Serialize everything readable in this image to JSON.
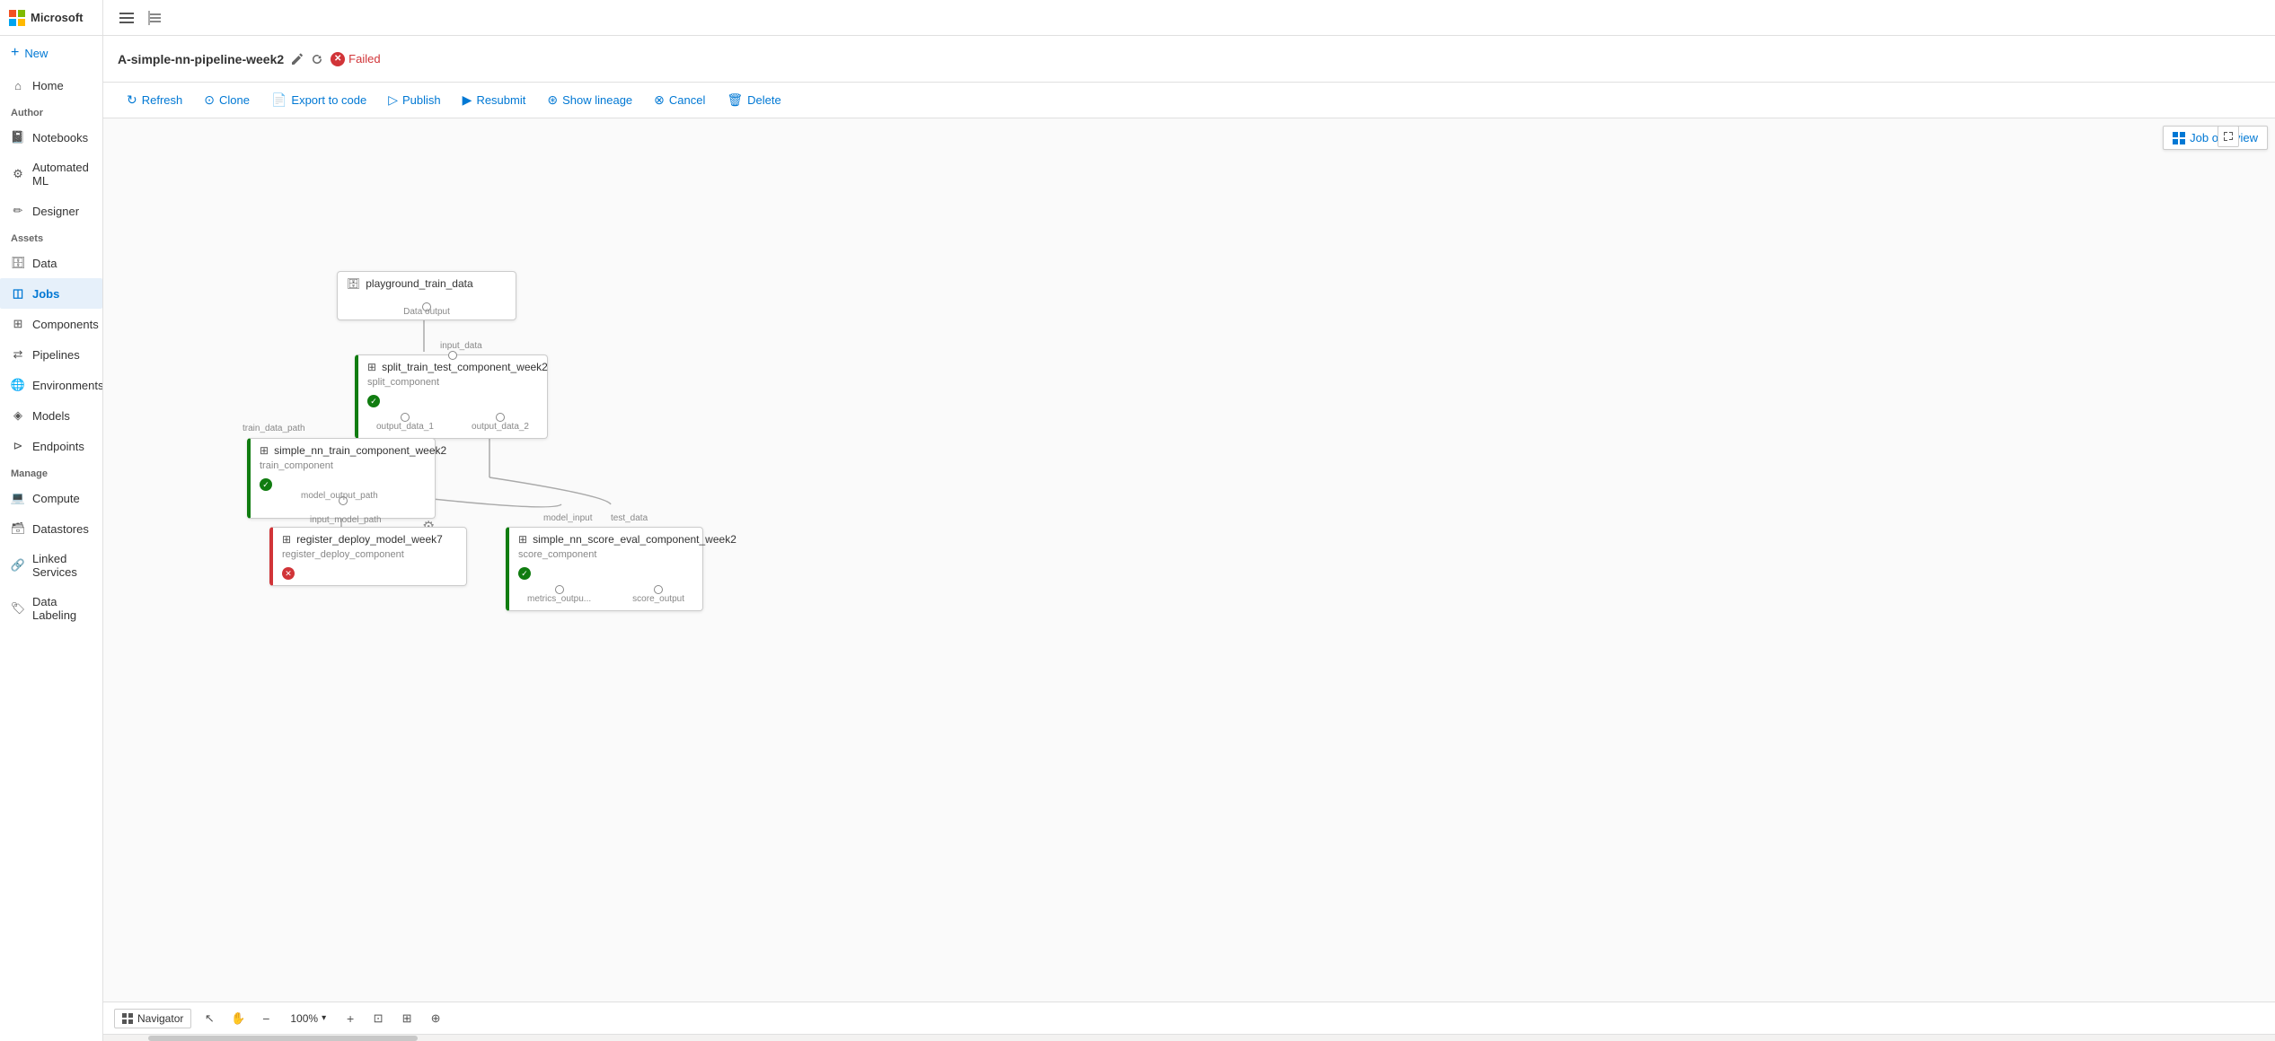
{
  "app": {
    "title": "Microsoft"
  },
  "sidebar": {
    "new_label": "New",
    "home_label": "Home",
    "author_section": "Author",
    "notebooks_label": "Notebooks",
    "automated_ml_label": "Automated ML",
    "designer_label": "Designer",
    "assets_section": "Assets",
    "data_label": "Data",
    "jobs_label": "Jobs",
    "components_label": "Components",
    "pipelines_label": "Pipelines",
    "environments_label": "Environments",
    "models_label": "Models",
    "endpoints_label": "Endpoints",
    "manage_section": "Manage",
    "compute_label": "Compute",
    "datastores_label": "Datastores",
    "linked_services_label": "Linked Services",
    "data_labeling_label": "Data Labeling"
  },
  "pipeline": {
    "title": "A-simple-nn-pipeline-week2",
    "status": "Failed",
    "nodes": {
      "data_source": {
        "title": "playground_train_data",
        "port_out": "Data output"
      },
      "split": {
        "title": "split_train_test_component_week2",
        "subtitle": "split_component",
        "port_in": "input_data",
        "port_out1": "output_data_1",
        "port_out2": "output_data_2"
      },
      "train": {
        "title": "simple_nn_train_component_week2",
        "subtitle": "train_component",
        "port_in": "train_data_path",
        "port_out": "model_output_path"
      },
      "register": {
        "title": "register_deploy_model_week7",
        "subtitle": "register_deploy_component",
        "port_in1": "input_model_path"
      },
      "score": {
        "title": "simple_nn_score_eval_component_week2",
        "subtitle": "score_component",
        "port_in1": "model_input",
        "port_in2": "test_data",
        "port_out1": "metrics_outpu...",
        "port_out2": "score_output"
      }
    }
  },
  "toolbar": {
    "refresh": "Refresh",
    "clone": "Clone",
    "export_to_code": "Export to code",
    "publish": "Publish",
    "resubmit": "Resubmit",
    "show_lineage": "Show lineage",
    "cancel": "Cancel",
    "delete": "Delete",
    "job_overview": "Job overview"
  },
  "bottom_bar": {
    "navigator": "Navigator",
    "zoom": "100%"
  }
}
